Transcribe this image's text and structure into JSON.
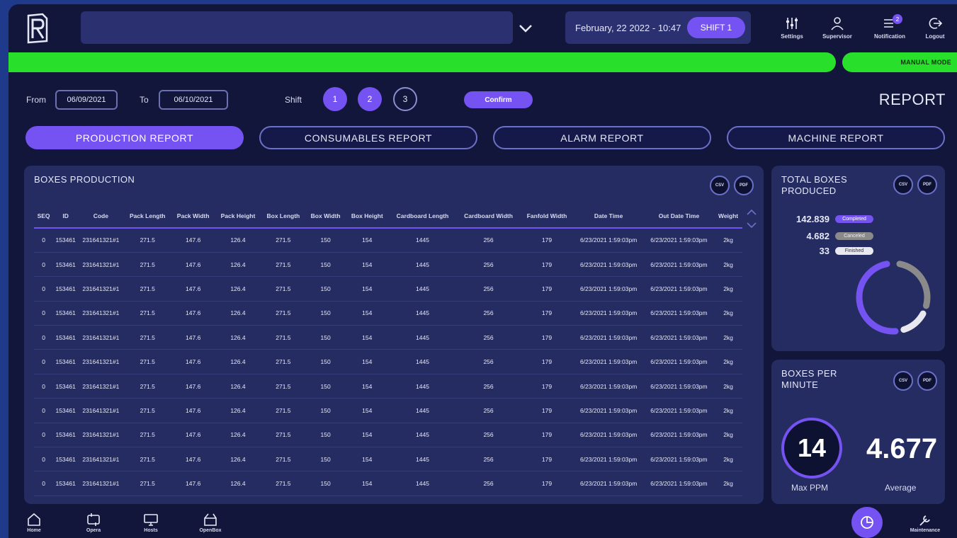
{
  "header": {
    "datetime": "February, 22 2022 - 10:47",
    "shift_label": "SHIFT 1",
    "buttons": [
      {
        "label": "Settings",
        "icon": "sliders-icon"
      },
      {
        "label": "Supervisor",
        "icon": "user-icon"
      },
      {
        "label": "Notification",
        "icon": "bell-list-icon",
        "badge": "2"
      },
      {
        "label": "Logout",
        "icon": "logout-icon"
      }
    ]
  },
  "status": {
    "mode": "MANUAL MODE",
    "color": "#28e02b"
  },
  "filters": {
    "from_label": "From",
    "from_value": "06/09/2021",
    "to_label": "To",
    "to_value": "06/10/2021",
    "shift_label": "Shift",
    "shifts": [
      "1",
      "2",
      "3"
    ],
    "confirm_label": "Confirm"
  },
  "page_title": "REPORT",
  "tabs": [
    {
      "label": "PRODUCTION REPORT",
      "active": true
    },
    {
      "label": "CONSUMABLES REPORT",
      "active": false
    },
    {
      "label": "ALARM REPORT",
      "active": false
    },
    {
      "label": "MACHINE REPORT",
      "active": false
    }
  ],
  "boxes_production": {
    "title": "BOXES PRODUCTION",
    "csv": "CSV",
    "pdf": "PDF",
    "columns": [
      "SEQ",
      "ID",
      "Code",
      "Pack Length",
      "Pack Width",
      "Pack Height",
      "Box Length",
      "Box Width",
      "Box Height",
      "Cardboard Length",
      "Cardboard Width",
      "Fanfold Width",
      "Date Time",
      "Out Date Time",
      "Weight"
    ],
    "rows": [
      [
        "0",
        "153461",
        "231641321#1",
        "271.5",
        "147.6",
        "126.4",
        "271.5",
        "150",
        "154",
        "1445",
        "256",
        "179",
        "6/23/2021 1:59:03pm",
        "6/23/2021 1:59:03pm",
        "2kg"
      ],
      [
        "0",
        "153461",
        "231641321#1",
        "271.5",
        "147.6",
        "126.4",
        "271.5",
        "150",
        "154",
        "1445",
        "256",
        "179",
        "6/23/2021 1:59:03pm",
        "6/23/2021 1:59:03pm",
        "2kg"
      ],
      [
        "0",
        "153461",
        "231641321#1",
        "271.5",
        "147.6",
        "126.4",
        "271.5",
        "150",
        "154",
        "1445",
        "256",
        "179",
        "6/23/2021 1:59:03pm",
        "6/23/2021 1:59:03pm",
        "2kg"
      ],
      [
        "0",
        "153461",
        "231641321#1",
        "271.5",
        "147.6",
        "126.4",
        "271.5",
        "150",
        "154",
        "1445",
        "256",
        "179",
        "6/23/2021 1:59:03pm",
        "6/23/2021 1:59:03pm",
        "2kg"
      ],
      [
        "0",
        "153461",
        "231641321#1",
        "271.5",
        "147.6",
        "126.4",
        "271.5",
        "150",
        "154",
        "1445",
        "256",
        "179",
        "6/23/2021 1:59:03pm",
        "6/23/2021 1:59:03pm",
        "2kg"
      ],
      [
        "0",
        "153461",
        "231641321#1",
        "271.5",
        "147.6",
        "126.4",
        "271.5",
        "150",
        "154",
        "1445",
        "256",
        "179",
        "6/23/2021 1:59:03pm",
        "6/23/2021 1:59:03pm",
        "2kg"
      ],
      [
        "0",
        "153461",
        "231641321#1",
        "271.5",
        "147.6",
        "126.4",
        "271.5",
        "150",
        "154",
        "1445",
        "256",
        "179",
        "6/23/2021 1:59:03pm",
        "6/23/2021 1:59:03pm",
        "2kg"
      ],
      [
        "0",
        "153461",
        "231641321#1",
        "271.5",
        "147.6",
        "126.4",
        "271.5",
        "150",
        "154",
        "1445",
        "256",
        "179",
        "6/23/2021 1:59:03pm",
        "6/23/2021 1:59:03pm",
        "2kg"
      ],
      [
        "0",
        "153461",
        "231641321#1",
        "271.5",
        "147.6",
        "126.4",
        "271.5",
        "150",
        "154",
        "1445",
        "256",
        "179",
        "6/23/2021 1:59:03pm",
        "6/23/2021 1:59:03pm",
        "2kg"
      ],
      [
        "0",
        "153461",
        "231641321#1",
        "271.5",
        "147.6",
        "126.4",
        "271.5",
        "150",
        "154",
        "1445",
        "256",
        "179",
        "6/23/2021 1:59:03pm",
        "6/23/2021 1:59:03pm",
        "2kg"
      ],
      [
        "0",
        "153461",
        "231641321#1",
        "271.5",
        "147.6",
        "126.4",
        "271.5",
        "150",
        "154",
        "1445",
        "256",
        "179",
        "6/23/2021 1:59:03pm",
        "6/23/2021 1:59:03pm",
        "2kg"
      ]
    ]
  },
  "total_boxes": {
    "title": "TOTAL BOXES PRODUCED",
    "csv": "CSV",
    "pdf": "PDF",
    "stats": [
      {
        "value": "142.839",
        "label": "Completed",
        "color": "#7553f2"
      },
      {
        "value": "4.682",
        "label": "Canceled",
        "color": "#8a8a8a"
      },
      {
        "value": "33",
        "label": "Finished",
        "color": "#e8e8f0"
      }
    ],
    "donut_fractions": [
      0.5,
      0.28,
      0.14
    ]
  },
  "boxes_per_minute": {
    "title": "BOXES PER MINUTE",
    "csv": "CSV",
    "pdf": "PDF",
    "max_value": "14",
    "max_label": "Max PPM",
    "avg_value": "4.677",
    "avg_label": "Average"
  },
  "bottom_nav": [
    {
      "label": "Home",
      "icon": "home-icon"
    },
    {
      "label": "Opera",
      "icon": "cycle-icon"
    },
    {
      "label": "Hosts",
      "icon": "monitor-icon"
    },
    {
      "label": "OpenBox",
      "icon": "open-box-icon"
    },
    {
      "label": "Maintenance",
      "icon": "wrench-icon"
    }
  ],
  "colors": {
    "accent": "#7553f2",
    "background": "#12163a",
    "panel": "#252c62",
    "status_green": "#28e02b"
  }
}
